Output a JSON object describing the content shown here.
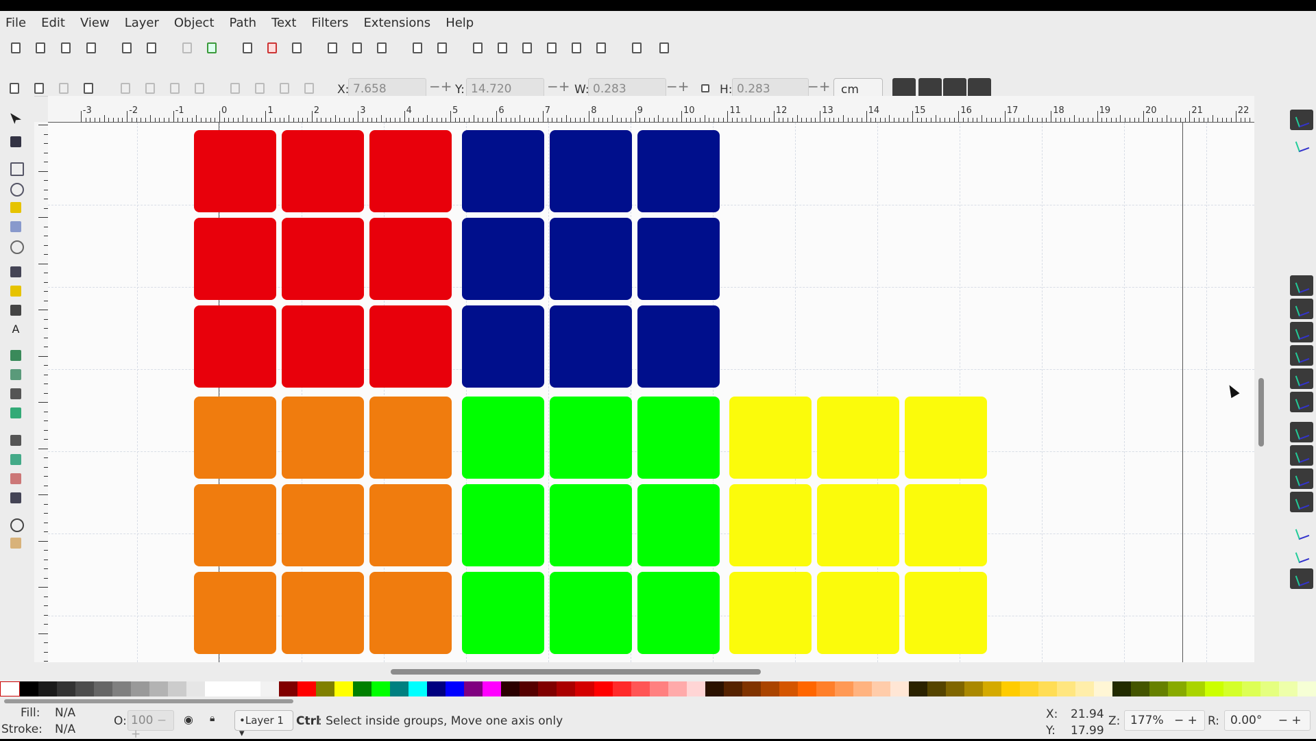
{
  "menubar": {
    "items": [
      "File",
      "Edit",
      "View",
      "Layer",
      "Object",
      "Path",
      "Text",
      "Filters",
      "Extensions",
      "Help"
    ]
  },
  "controls": {
    "x_label": "X:",
    "x_value": "7.658",
    "y_label": "Y:",
    "y_value": "14.720",
    "w_label": "W:",
    "w_value": "0.283",
    "h_label": "H:",
    "h_value": "0.283",
    "unit": "cm"
  },
  "ruler": {
    "labels": [
      "-3",
      "-2",
      "-1",
      "0",
      "1",
      "2",
      "3",
      "4",
      "5",
      "6",
      "7",
      "8",
      "9",
      "10",
      "11",
      "12",
      "13",
      "14",
      "15",
      "16",
      "17",
      "18",
      "19",
      "20",
      "21",
      "22"
    ]
  },
  "tiles": {
    "groups": [
      {
        "name": "red",
        "color": "#e8000b"
      },
      {
        "name": "navy",
        "color": "#000f8c"
      },
      {
        "name": "orange",
        "color": "#f07c0e"
      },
      {
        "name": "green",
        "color": "#00ff00"
      },
      {
        "name": "yellow",
        "color": "#fbfb0b"
      }
    ]
  },
  "palette": {
    "colors": [
      "#000000",
      "#1a1a1a",
      "#333333",
      "#4d4d4d",
      "#666666",
      "#808080",
      "#999999",
      "#b3b3b3",
      "#cccccc",
      "#e6e6e6",
      "#ffffff",
      "#ffffff",
      "#ffffff",
      "#f2f2f2",
      "#800000",
      "#ff0000",
      "#808000",
      "#ffff00",
      "#008000",
      "#00ff00",
      "#008080",
      "#00ffff",
      "#000080",
      "#0000ff",
      "#800080",
      "#ff00ff",
      "#2b0000",
      "#550000",
      "#800000",
      "#aa0000",
      "#d40000",
      "#ff0000",
      "#ff2a2a",
      "#ff5555",
      "#ff8080",
      "#ffaaaa",
      "#ffd5d5",
      "#2b1100",
      "#552200",
      "#803300",
      "#aa4400",
      "#d45500",
      "#ff6600",
      "#ff7f2a",
      "#ff9955",
      "#ffb380",
      "#ffccaa",
      "#ffe6d5",
      "#2b2200",
      "#554400",
      "#806600",
      "#aa8800",
      "#d4aa00",
      "#ffcc00",
      "#ffd42a",
      "#ffdd55",
      "#ffe680",
      "#ffeeaa",
      "#fff6d5",
      "#222b00",
      "#445500",
      "#668000",
      "#88aa00",
      "#aad400",
      "#ccff00",
      "#d4ff2a",
      "#ddff55",
      "#e5ff80",
      "#eeffaa",
      "#f6ffd5"
    ]
  },
  "status": {
    "fill_label": "Fill:",
    "fill_value": "N/A",
    "stroke_label": "Stroke:",
    "stroke_value": "N/A",
    "opacity_label": "O:",
    "opacity_value": "100",
    "layer": "•Layer 1",
    "message_bold": "Ctrl",
    "message": ": Select inside groups, Move one axis only",
    "cx_label": "X:",
    "cx_value": "21.94",
    "cy_label": "Y:",
    "cy_value": "17.99",
    "zoom_label": "Z:",
    "zoom_value": "177%",
    "rot_label": "R:",
    "rot_value": "0.00°"
  }
}
